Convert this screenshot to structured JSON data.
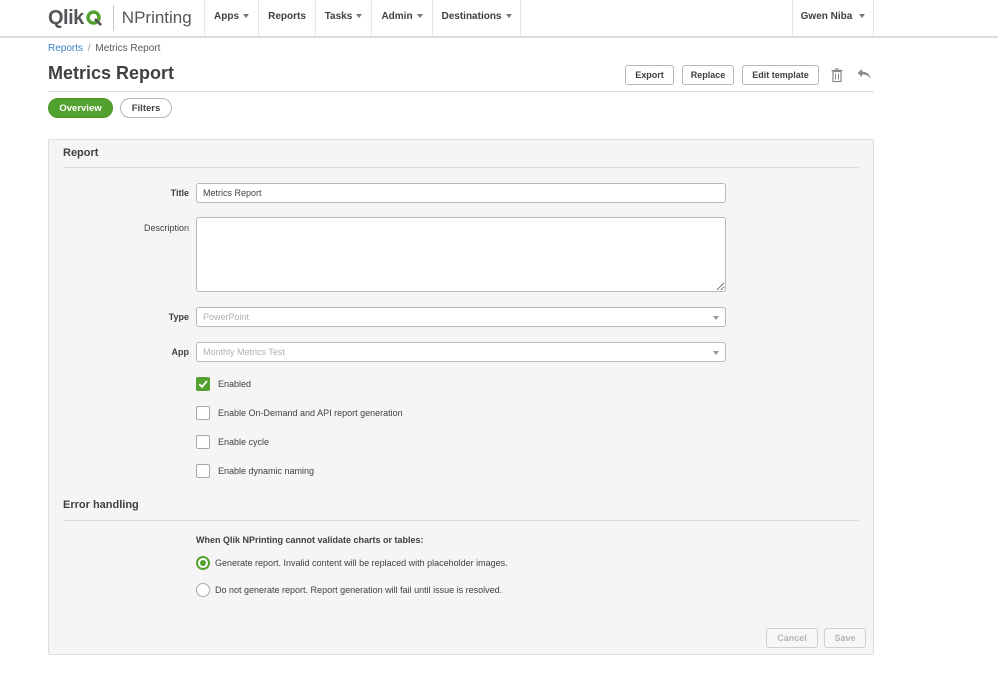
{
  "app": {
    "brand": "Qlik",
    "product": "NPrinting"
  },
  "nav": {
    "items": [
      {
        "label": "Apps",
        "has_caret": true
      },
      {
        "label": "Reports",
        "has_caret": false
      },
      {
        "label": "Tasks",
        "has_caret": true
      },
      {
        "label": "Admin",
        "has_caret": true
      },
      {
        "label": "Destinations",
        "has_caret": true
      }
    ],
    "user": "Gwen Niba"
  },
  "breadcrumb": {
    "parent": "Reports",
    "separator": "/",
    "current": "Metrics Report"
  },
  "page": {
    "title": "Metrics Report"
  },
  "toolbar": {
    "export_label": "Export",
    "replace_label": "Replace",
    "edit_template_label": "Edit template",
    "delete_icon": "trash-icon",
    "back_icon": "reply-arrow-icon"
  },
  "tabs": [
    {
      "label": "Overview",
      "active": true
    },
    {
      "label": "Filters",
      "active": false
    }
  ],
  "report_section": {
    "heading": "Report",
    "title_label": "Title",
    "title_value": "Metrics Report",
    "description_label": "Description",
    "description_value": "",
    "type_label": "Type",
    "type_value": "PowerPoint",
    "app_label": "App",
    "app_value": "Monthly Metrics Test",
    "checkboxes": [
      {
        "label": "Enabled",
        "checked": true
      },
      {
        "label": "Enable On-Demand and API report generation",
        "checked": false
      },
      {
        "label": "Enable cycle",
        "checked": false
      },
      {
        "label": "Enable dynamic naming",
        "checked": false
      }
    ]
  },
  "error_section": {
    "heading": "Error handling",
    "question": "When Qlik NPrinting cannot validate charts or tables:",
    "options": [
      {
        "label": "Generate report. Invalid content will be replaced with placeholder images.",
        "selected": true
      },
      {
        "label": "Do not generate report. Report generation will fail until issue is resolved.",
        "selected": false
      }
    ]
  },
  "footer": {
    "cancel_label": "Cancel",
    "save_label": "Save"
  },
  "colors": {
    "accent": "#52a12e",
    "link": "#3a7fc1",
    "text": "#404040"
  }
}
